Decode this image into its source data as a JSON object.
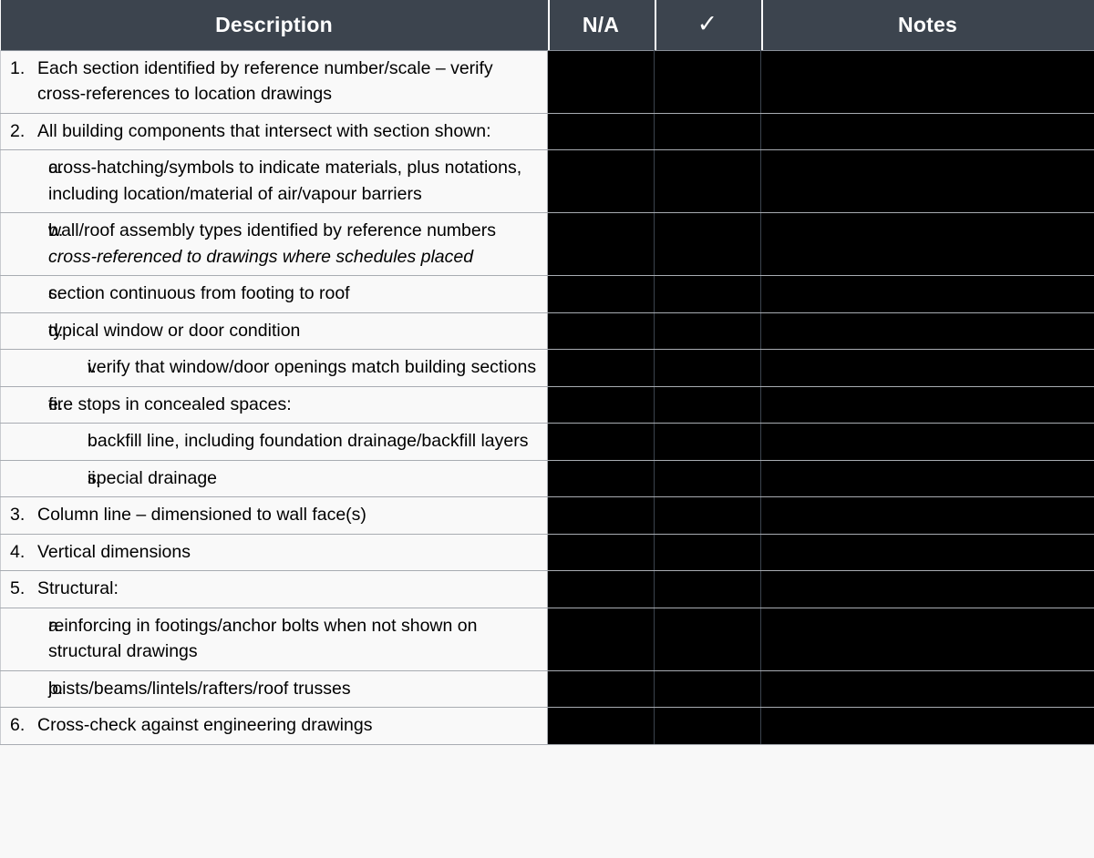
{
  "table": {
    "columns": [
      {
        "key": "description",
        "label": "Description"
      },
      {
        "key": "na",
        "label": "N/A"
      },
      {
        "key": "check",
        "label": "✓"
      },
      {
        "key": "notes",
        "label": "Notes"
      }
    ],
    "colors": {
      "header_background": "#3C444E",
      "header_text": "#FFFFFF",
      "row_background": "#F9F9F9",
      "fill_cell_background": "#000000",
      "gridline": "#A8ACB2",
      "text": "#000000"
    },
    "rows": [
      {
        "level": "num",
        "marker": "1.",
        "text": "Each section identified by reference number/scale – verify cross-references to location drawings",
        "na": "",
        "check": "",
        "notes": ""
      },
      {
        "level": "num",
        "marker": "2.",
        "text": "All building components that intersect with section shown:",
        "na": "",
        "check": "",
        "notes": ""
      },
      {
        "level": "alpha",
        "marker": "a.",
        "text": "cross-hatching/symbols to indicate materials, plus notations, including location/material of air/vapour barriers",
        "na": "",
        "check": "",
        "notes": ""
      },
      {
        "level": "alpha",
        "marker": "b.",
        "text": "wall/roof assembly types identified by reference numbers ",
        "text_italic": "cross-referenced to drawings where schedules placed",
        "na": "",
        "check": "",
        "notes": ""
      },
      {
        "level": "alpha",
        "marker": "c.",
        "text": "section continuous from footing to roof",
        "na": "",
        "check": "",
        "notes": ""
      },
      {
        "level": "alpha",
        "marker": "d.",
        "text": "typical window or door condition",
        "na": "",
        "check": "",
        "notes": ""
      },
      {
        "level": "roman",
        "marker": "i.",
        "text": "verify that window/door openings match building sections",
        "na": "",
        "check": "",
        "notes": ""
      },
      {
        "level": "alpha",
        "marker": "e.",
        "text": "fire stops in concealed spaces:",
        "na": "",
        "check": "",
        "notes": ""
      },
      {
        "level": "roman",
        "marker": "i.",
        "text": "backfill line, including foundation drainage/backfill layers",
        "na": "",
        "check": "",
        "notes": ""
      },
      {
        "level": "roman",
        "marker": "ii.",
        "text": "special drainage",
        "na": "",
        "check": "",
        "notes": ""
      },
      {
        "level": "num",
        "marker": "3.",
        "text": "Column line – dimensioned to wall face(s)",
        "na": "",
        "check": "",
        "notes": ""
      },
      {
        "level": "num",
        "marker": "4.",
        "text": "Vertical dimensions",
        "na": "",
        "check": "",
        "notes": ""
      },
      {
        "level": "num",
        "marker": "5.",
        "text": "Structural:",
        "na": "",
        "check": "",
        "notes": ""
      },
      {
        "level": "alpha",
        "marker": "a.",
        "text": "reinforcing in footings/anchor bolts when not shown on structural drawings",
        "na": "",
        "check": "",
        "notes": ""
      },
      {
        "level": "alpha",
        "marker": "b.",
        "text": "joists/beams/lintels/rafters/roof trusses",
        "na": "",
        "check": "",
        "notes": ""
      },
      {
        "level": "num",
        "marker": "6.",
        "text": "Cross-check against engineering drawings",
        "na": "",
        "check": "",
        "notes": ""
      }
    ]
  }
}
